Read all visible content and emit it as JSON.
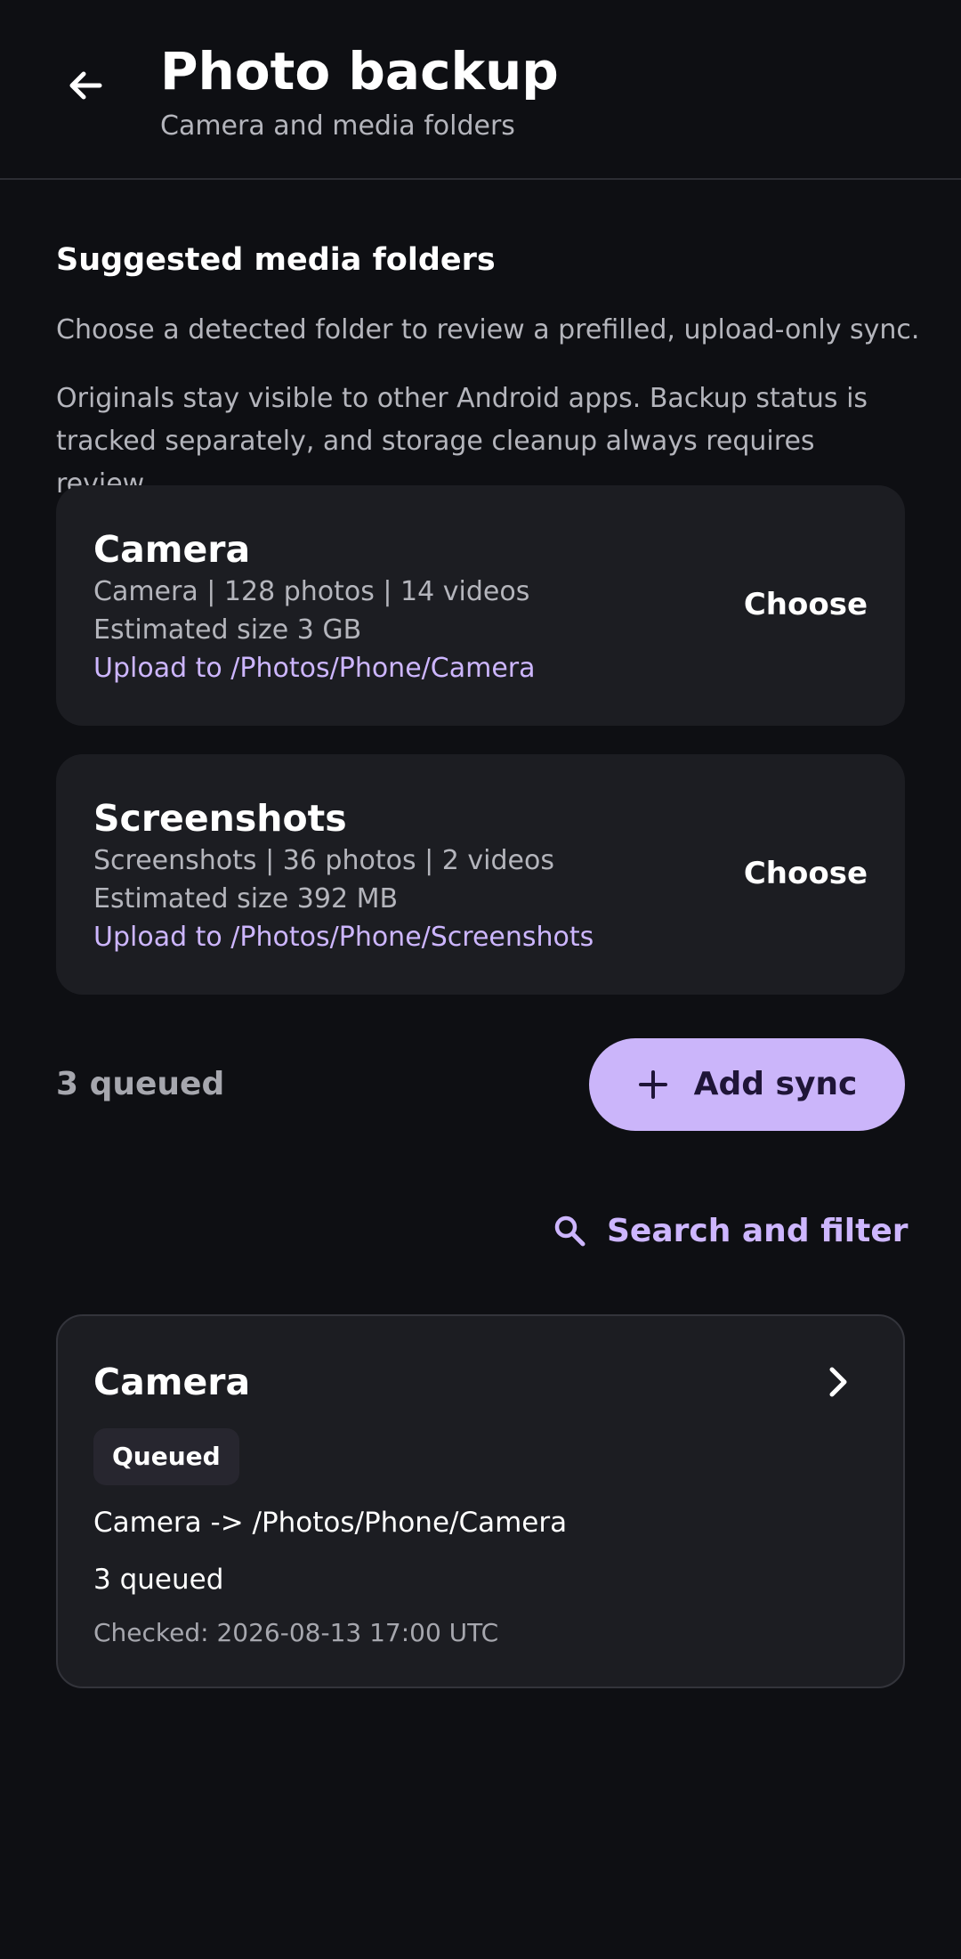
{
  "header": {
    "back_icon": "arrow-left-icon",
    "title": "Photo backup",
    "subtitle": "Camera and media folders"
  },
  "suggested": {
    "heading": "Suggested media folders",
    "description": "Choose a detected folder to review a prefilled, upload-only sync.",
    "note": "Originals stay visible to other Android apps. Backup status is tracked separately, and storage cleanup always requires review.",
    "folders": [
      {
        "name": "Camera",
        "summary": "Camera | 128 photos | 14 videos",
        "size": "Estimated size 3 GB",
        "destination": "Upload to /Photos/Phone/Camera",
        "action": "Choose"
      },
      {
        "name": "Screenshots",
        "summary": "Screenshots | 36 photos | 2 videos",
        "size": "Estimated size 392 MB",
        "destination": "Upload to /Photos/Phone/Screenshots",
        "action": "Choose"
      }
    ]
  },
  "syncs": {
    "queued_summary": "3 queued",
    "add_label": "Add sync",
    "add_icon": "plus-icon",
    "search_label": "Search and filter",
    "search_icon": "search-icon",
    "items": [
      {
        "name": "Camera",
        "status": "Queued",
        "route": "Camera -> /Photos/Phone/Camera",
        "queued": "3 queued",
        "checked": "Checked: 2026-08-13 17:00 UTC",
        "chevron_icon": "chevron-right-icon"
      }
    ]
  },
  "colors": {
    "background": "#0e0f13",
    "card": "#1c1d22",
    "accent": "#cbb5fa",
    "accent_text": "#cdb6ff",
    "muted_text": "#b4b5bc"
  }
}
